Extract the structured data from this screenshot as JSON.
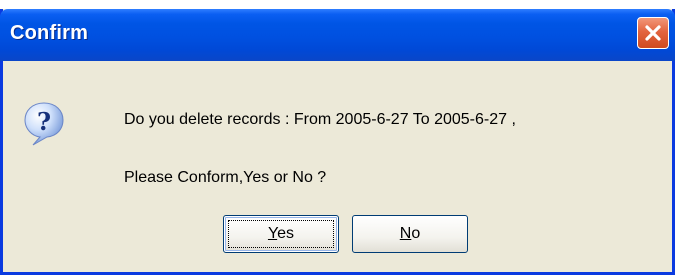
{
  "window": {
    "title": "Confirm",
    "close_icon": "close-icon"
  },
  "message": {
    "icon": "question-icon",
    "line1": "Do you delete records : From 2005-6-27 To 2005-6-27 ,",
    "line2": "Please Conform,Yes or No ?"
  },
  "buttons": {
    "yes": {
      "mnemonic": "Y",
      "rest": "es"
    },
    "no": {
      "mnemonic": "N",
      "rest": "o"
    }
  },
  "colors": {
    "title_bar": "#0055e5",
    "frame": "#0a3ae0",
    "body": "#ece9d8",
    "close_button": "#e3643f"
  }
}
